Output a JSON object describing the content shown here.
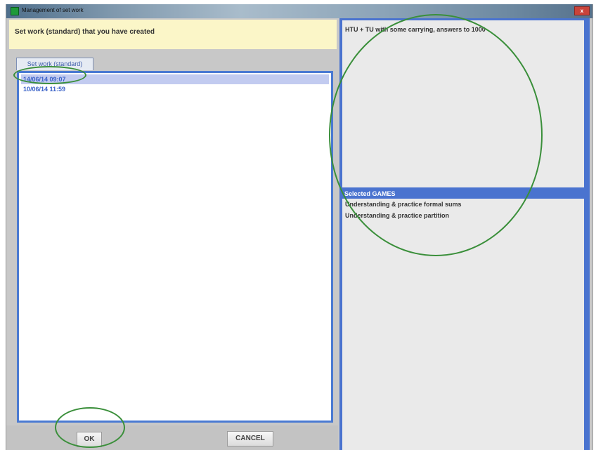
{
  "window": {
    "title": "Management of set work",
    "close_label": "x"
  },
  "header": {
    "text": "Set work (standard) that you have created"
  },
  "tab": {
    "label": "Set work (standard)"
  },
  "list": {
    "items": [
      {
        "label": "14/06/14 09:07",
        "selected": true
      },
      {
        "label": "10/06/14 11:59",
        "selected": false
      }
    ]
  },
  "buttons": {
    "ok": "OK",
    "cancel": "CANCEL"
  },
  "details": {
    "description": "HTU + TU with some carrying, answers to 1000",
    "games_header": "Selected GAMES",
    "games": [
      "Understanding & practice formal sums",
      "Understanding & practice partition"
    ]
  },
  "colors": {
    "accent_blue": "#4a73cf",
    "header_yellow": "#fbf6c8",
    "annotation_green": "#3a8f3a"
  }
}
